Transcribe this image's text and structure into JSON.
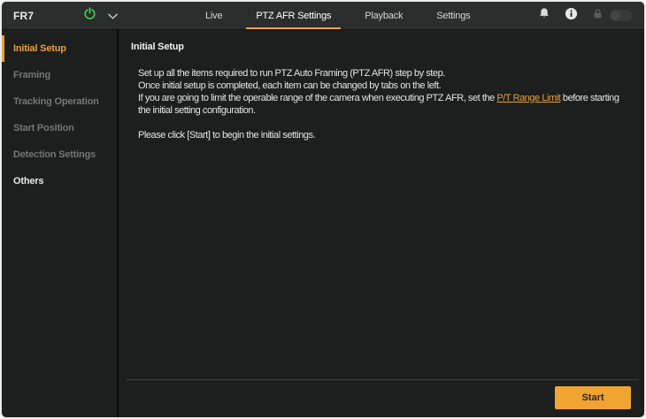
{
  "topbar": {
    "device_name": "FR7",
    "tabs": [
      {
        "label": "Live",
        "active": false
      },
      {
        "label": "PTZ AFR Settings",
        "active": true
      },
      {
        "label": "Playback",
        "active": false
      },
      {
        "label": "Settings",
        "active": false
      }
    ],
    "icons": {
      "power": "power-symbol (green)",
      "chevron": "chevron-down",
      "bell": "notification-bell",
      "info": "info-circle",
      "lock": "lock (disabled)",
      "toggle_state": "off-disabled"
    }
  },
  "sidebar": {
    "items": [
      {
        "label": "Initial Setup",
        "state": "active"
      },
      {
        "label": "Framing",
        "state": "disabled"
      },
      {
        "label": "Tracking Operation",
        "state": "disabled"
      },
      {
        "label": "Start Position",
        "state": "disabled"
      },
      {
        "label": "Detection Settings",
        "state": "disabled"
      },
      {
        "label": "Others",
        "state": "enabled"
      }
    ]
  },
  "main": {
    "heading": "Initial Setup",
    "intro_line1": "Set up all the items required to run PTZ Auto Framing (PTZ AFR) step by step.",
    "intro_line2": "Once initial setup is completed, each item can be changed by tabs on the left.",
    "range_sentence": {
      "before_link": "If you are going to limit the operable range of the camera when executing PTZ AFR, set the ",
      "link_text": "P/T Range Limit",
      "after_link": " before starting"
    },
    "range_sentence_wrap": "the initial setting configuration.",
    "note": "Please click [Start] to begin the initial settings.",
    "start_button_label": "Start"
  },
  "colors": {
    "accent_orange": "#e9a13b",
    "tab_underline": "#f0a636",
    "start_button_bg": "#f0a432",
    "power_green": "#3ecf4a",
    "topbar_bg": "#2c2d2d",
    "content_bg": "#1d1e1e"
  }
}
